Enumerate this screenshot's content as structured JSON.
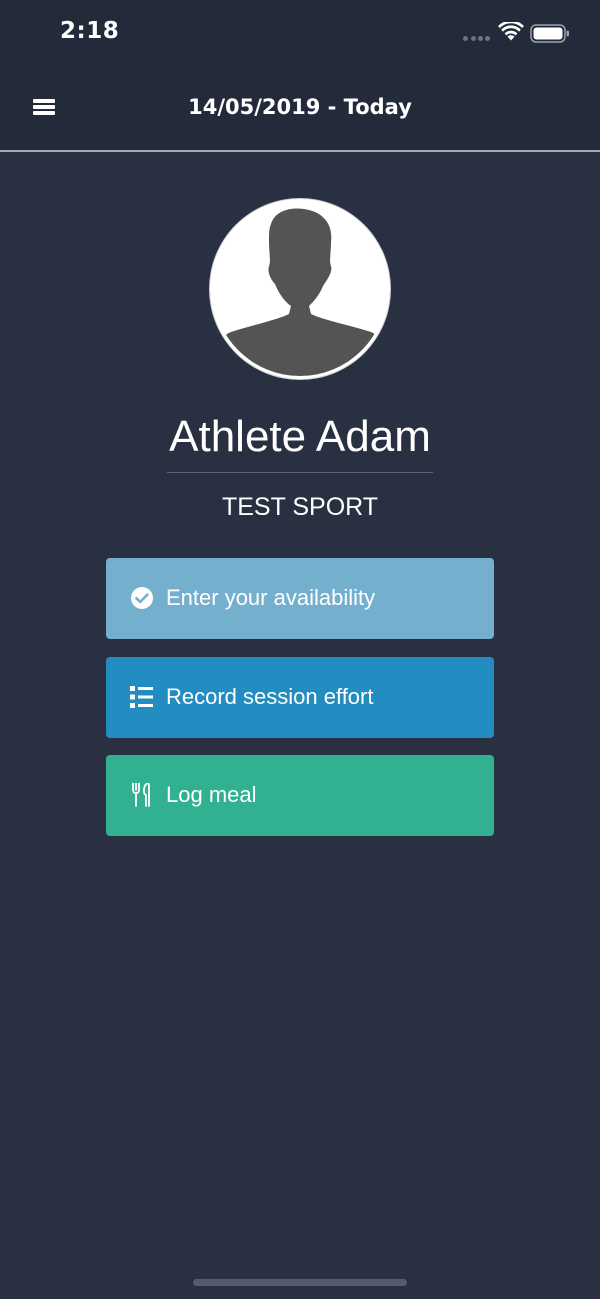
{
  "status_bar": {
    "time": "2:18"
  },
  "nav": {
    "title": "14/05/2019 - Today"
  },
  "profile": {
    "name": "Athlete Adam",
    "sport": "TEST SPORT"
  },
  "actions": [
    {
      "label": "Enter your availability",
      "icon": "check-circle-icon",
      "color": "#74b0cd"
    },
    {
      "label": "Record session effort",
      "icon": "list-icon",
      "color": "#238dc1"
    },
    {
      "label": "Log meal",
      "icon": "cutlery-icon",
      "color": "#31b092"
    }
  ],
  "colors": {
    "background": "#293041",
    "nav_background": "#232a3a"
  }
}
